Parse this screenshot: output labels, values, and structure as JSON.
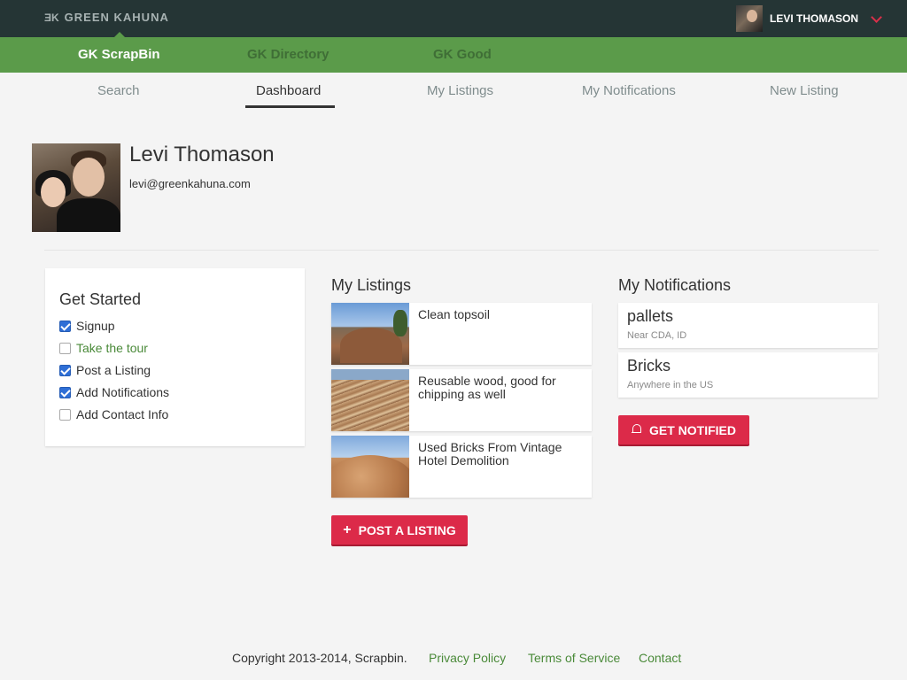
{
  "topbar": {
    "brand_mark": "ƎK",
    "brand_name": "GREEN KAHUNA",
    "user_name": "LEVI THOMASON"
  },
  "products": [
    "GK ScrapBin",
    "GK Directory",
    "GK Good"
  ],
  "tabs": [
    "Search",
    "Dashboard",
    "My Listings",
    "My Notifications",
    "New Listing"
  ],
  "active_tab": "Dashboard",
  "profile": {
    "name": "Levi Thomason",
    "email": "levi@greenkahuna.com"
  },
  "get_started": {
    "title": "Get Started",
    "items": [
      {
        "label": "Signup",
        "checked": true
      },
      {
        "label": "Take the tour",
        "checked": false
      },
      {
        "label": "Post a Listing",
        "checked": true
      },
      {
        "label": "Add Notifications",
        "checked": true
      },
      {
        "label": "Add Contact Info",
        "checked": false
      }
    ]
  },
  "listings": {
    "title": "My Listings",
    "items": [
      {
        "title": "Clean topsoil"
      },
      {
        "title": "Reusable wood, good for chipping as well"
      },
      {
        "title": "Used Bricks From Vintage Hotel Demolition"
      }
    ],
    "post_button": "POST A LISTING"
  },
  "notifications": {
    "title": "My Notifications",
    "items": [
      {
        "title": "pallets",
        "location": "Near CDA, ID"
      },
      {
        "title": "Bricks",
        "location": "Anywhere in the US"
      }
    ],
    "notify_button": "GET NOTIFIED"
  },
  "footer": {
    "copyright": "Copyright 2013-2014, Scrapbin.",
    "links": [
      "Privacy Policy",
      "Terms of Service",
      "Contact"
    ]
  },
  "colors": {
    "topbar": "#253535",
    "product_bar": "#5b9b4a",
    "accent_red": "#dc2a49",
    "link_green": "#4a8a39"
  }
}
